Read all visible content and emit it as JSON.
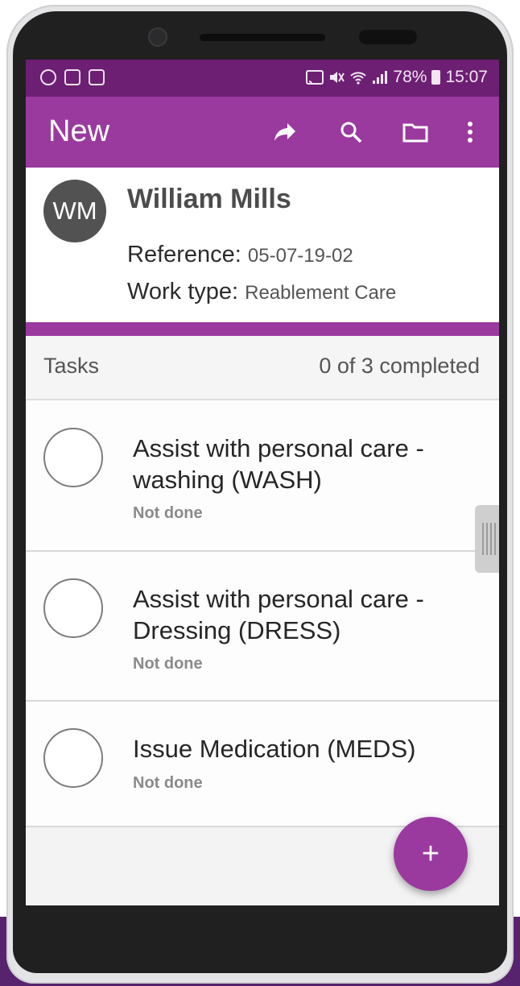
{
  "status_bar": {
    "battery": "78%",
    "time": "15:07"
  },
  "app_bar": {
    "title": "New"
  },
  "client": {
    "initials": "WM",
    "name": "William Mills",
    "reference_label": "Reference:",
    "reference_value": "05-07-19-02",
    "work_type_label": "Work type:",
    "work_type_value": "Reablement Care"
  },
  "tasks": {
    "header_label": "Tasks",
    "completed_summary": "0 of 3 completed",
    "items": [
      {
        "title": "Assist with personal care - washing (WASH)",
        "status": "Not done"
      },
      {
        "title": "Assist with personal care - Dressing (DRESS)",
        "status": "Not done"
      },
      {
        "title": "Issue Medication (MEDS)",
        "status": "Not done"
      }
    ]
  },
  "fab": {
    "label": "+"
  },
  "colors": {
    "status_bar": "#6d1f73",
    "primary": "#9a3a9f",
    "avatar": "#525252"
  },
  "icons": [
    "share-icon",
    "search-icon",
    "folder-icon",
    "more-vert-icon",
    "wifi-icon",
    "signal-icon",
    "battery-icon",
    "cast-icon",
    "mute-icon"
  ]
}
